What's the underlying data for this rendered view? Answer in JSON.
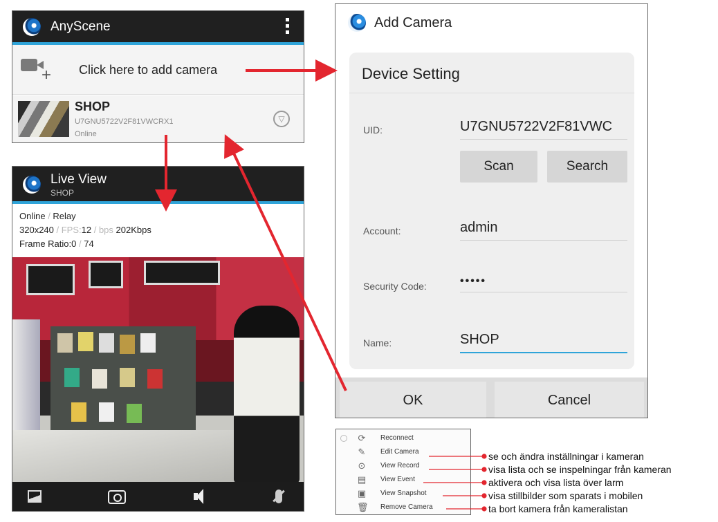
{
  "anyscene": {
    "title": "AnyScene",
    "add_label": "Click here to add camera",
    "camera": {
      "name": "SHOP",
      "uid": "U7GNU5722V2F81VWCRX1",
      "status": "Online"
    }
  },
  "live_view": {
    "title": "Live View",
    "subtitle": "SHOP",
    "stats": {
      "status": "Online",
      "mode": "Relay",
      "resolution": "320x240",
      "fps_label": "FPS:",
      "fps": "12",
      "bps_label": "bps",
      "bps": "202Kbps",
      "frame_ratio_label": "Frame Ratio:",
      "frame_ratio_a": "0",
      "frame_ratio_b": "74"
    }
  },
  "add_camera": {
    "title": "Add Camera",
    "section": "Device Setting",
    "uid_label": "UID:",
    "uid_value": "U7GNU5722V2F81VWC",
    "scan_label": "Scan",
    "search_label": "Search",
    "account_label": "Account:",
    "account_value": "admin",
    "security_label": "Security Code:",
    "security_value": "•••••",
    "name_label": "Name:",
    "name_value": "SHOP",
    "ok_label": "OK",
    "cancel_label": "Cancel"
  },
  "menu": {
    "items": [
      {
        "label": "Reconnect"
      },
      {
        "label": "Edit Camera",
        "note": "se och ändra inställningar i kameran"
      },
      {
        "label": "View Record",
        "note": "visa lista och se inspelningar från kameran"
      },
      {
        "label": "View Event",
        "note": "aktivera och visa lista över larm"
      },
      {
        "label": "View Snapshot",
        "note": "visa stillbilder som sparats i mobilen"
      },
      {
        "label": "Remove Camera",
        "note": "ta bort kamera från kameralistan"
      }
    ]
  },
  "colors": {
    "accent_blue": "#2fa4d9",
    "annotation_red": "#e3262f",
    "header_dark": "#202020"
  }
}
